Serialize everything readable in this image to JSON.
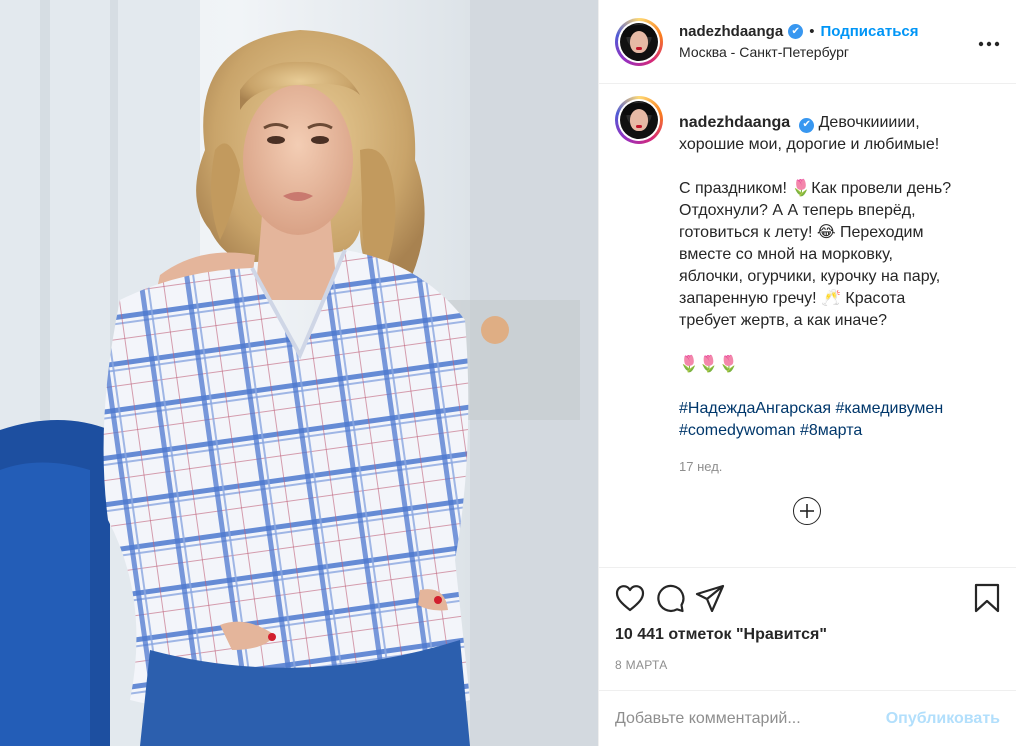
{
  "post": {
    "username": "nadezhdaanga",
    "verified_mark": "✔",
    "separator": "•",
    "follow_label": "Подписаться",
    "location": "Москва - Санкт-Петербург",
    "more_icon": "more-horizontal-icon"
  },
  "caption": {
    "username": "nadezhdaanga",
    "line1": "Девочкиииии,\nхорошие мои, дорогие и любимые!",
    "para2": "С праздником! 🌷Как провели день?\nОтдохнули? А А теперь вперёд,\nготовиться к лету! 😂 Переходим\nвместе со мной на морковку,\nяблочки, огурчики, курочку на пару,\nзапаренную гречу! 🥂 Красота\nтребует жертв, а как иначе?",
    "para3": "🌷🌷🌷",
    "hashtags": "#НадеждаАнгарская #камедивумен\n#comedywoman #8марта",
    "time_ago": "17 нед."
  },
  "load_more_icon": "plus-circle-icon",
  "actions": {
    "like_icon": "heart-icon",
    "comment_icon": "comment-icon",
    "share_icon": "share-icon",
    "save_icon": "bookmark-icon"
  },
  "likes": "10 441 отметок \"Нравится\"",
  "date": "8 МАРТА",
  "comment": {
    "placeholder": "Добавьте комментарий...",
    "value": "",
    "publish_label": "Опубликовать"
  },
  "colors": {
    "accent": "#0095f6",
    "publish_disabled": "#b2dffc",
    "hashtag": "#00376b",
    "muted": "#8e8e8e"
  }
}
